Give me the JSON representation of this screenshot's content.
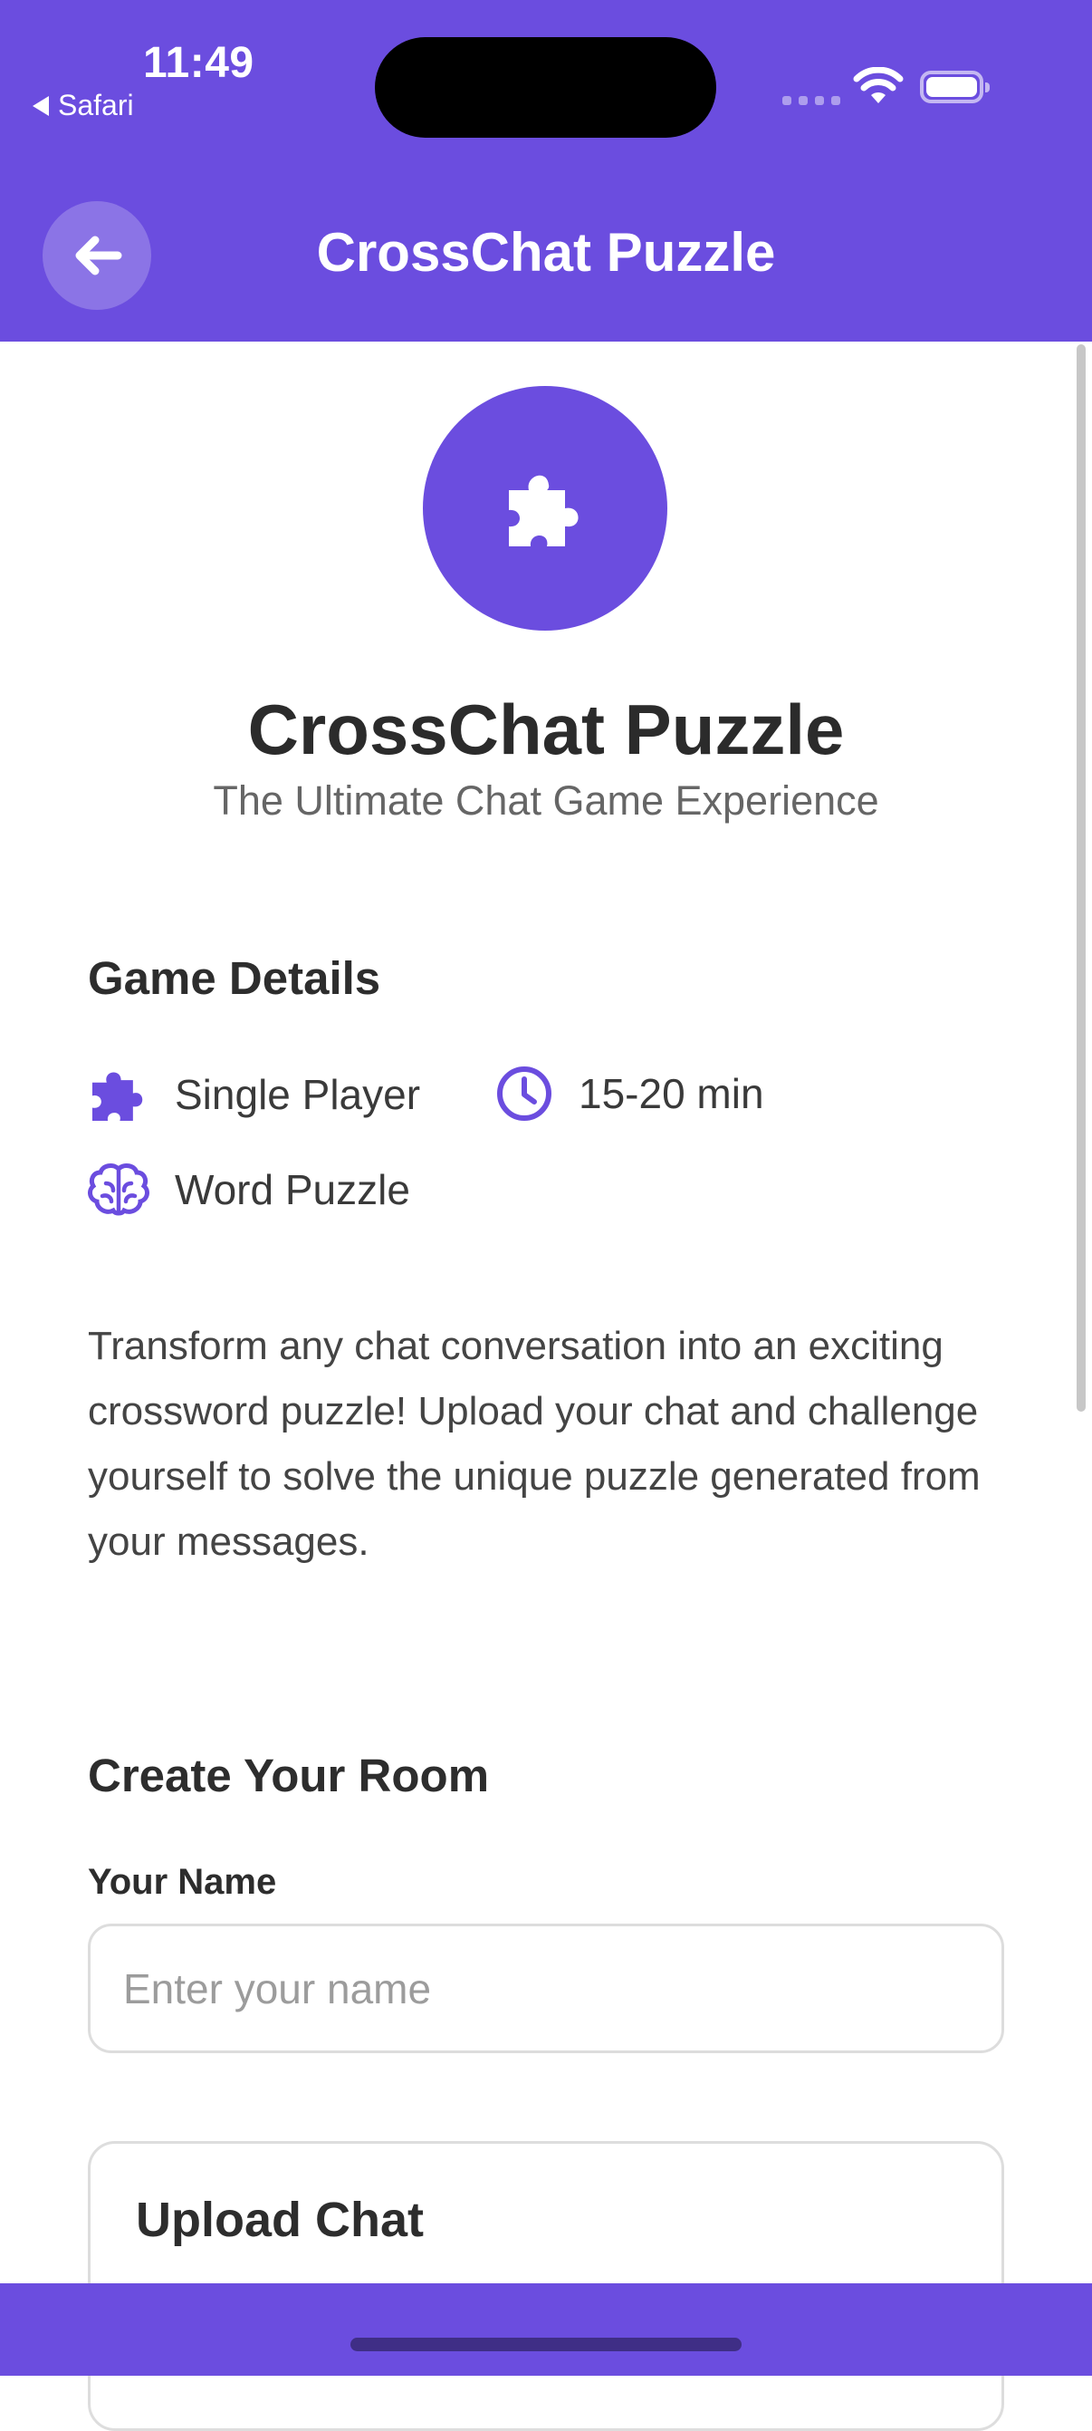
{
  "status_bar": {
    "time": "11:49",
    "back_app": "Safari"
  },
  "header": {
    "title": "CrossChat Puzzle",
    "back_icon": "arrow-left-icon",
    "color": "#6b4ddf"
  },
  "hero": {
    "icon": "puzzle-piece-icon",
    "title": "CrossChat Puzzle",
    "subtitle": "The Ultimate Chat Game Experience"
  },
  "game_details": {
    "title": "Game Details",
    "items": [
      {
        "icon": "puzzle-piece-icon",
        "label": "Single Player"
      },
      {
        "icon": "clock-icon",
        "label": "15-20 min"
      },
      {
        "icon": "brain-icon",
        "label": "Word Puzzle"
      }
    ],
    "description": "Transform any chat conversation into an exciting crossword puzzle! Upload your chat and challenge yourself to solve the unique puzzle generated from your messages."
  },
  "create_room": {
    "title": "Create Your Room",
    "name_label": "Your Name",
    "name_placeholder": "Enter your name",
    "name_value": ""
  },
  "upload": {
    "title": "Upload Chat"
  }
}
